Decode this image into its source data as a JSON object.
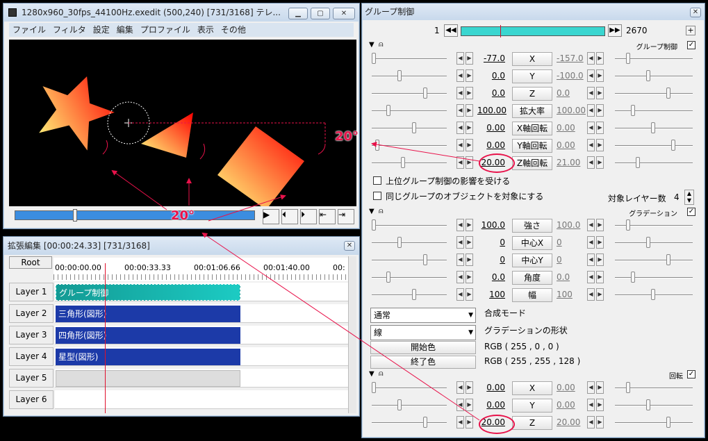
{
  "preview_window": {
    "title": "1280x960_30fps_44100Hz.exedit (500,240)  [731/3168]  テレ...",
    "menu": [
      "ファイル",
      "フィルタ",
      "設定",
      "編集",
      "プロファイル",
      "表示",
      "その他"
    ]
  },
  "timeline_window": {
    "title": "拡張編集 [00:00:24.33] [731/3168]",
    "root_label": "Root",
    "times": [
      "00:00:00.00",
      "00:00:33.33",
      "00:01:06.66",
      "00:01:40.00",
      "00:"
    ],
    "layers": [
      {
        "label": "Layer 1",
        "clip": "グループ制御",
        "color": "#19b8b2"
      },
      {
        "label": "Layer 2",
        "clip": "三角形(図形)",
        "color": "#1c3aa8"
      },
      {
        "label": "Layer 3",
        "clip": "四角形(図形)",
        "color": "#1c3aa8"
      },
      {
        "label": "Layer 4",
        "clip": "星型(図形)",
        "color": "#1c3aa8"
      },
      {
        "label": "Layer 5",
        "clip": "",
        "color": ""
      },
      {
        "label": "Layer 6",
        "clip": "",
        "color": ""
      }
    ]
  },
  "props_window": {
    "title": "グループ制御",
    "frame_start": "1",
    "frame_end": "2670",
    "group_section": {
      "label": "グループ制御",
      "checked": true
    },
    "group_rows": [
      {
        "left": "-77.0",
        "name": "X",
        "right": "-157.0"
      },
      {
        "left": "0.0",
        "name": "Y",
        "right": "-100.0"
      },
      {
        "left": "0.0",
        "name": "Z",
        "right": "0.0"
      },
      {
        "left": "100.00",
        "name": "拡大率",
        "right": "100.00"
      },
      {
        "left": "0.00",
        "name": "X軸回転",
        "right": "0.00"
      },
      {
        "left": "0.00",
        "name": "Y軸回転",
        "right": "0.00"
      },
      {
        "left": "20.00",
        "name": "Z軸回転",
        "right": "21.00"
      }
    ],
    "check1": "上位グループ制御の影響を受ける",
    "check2": "同じグループのオブジェクトを対象にする",
    "target_layers_label": "対象レイヤー数",
    "target_layers_value": "4",
    "grad_section": {
      "label": "グラデーション",
      "checked": true
    },
    "grad_rows": [
      {
        "left": "100.0",
        "name": "強さ",
        "right": "100.0"
      },
      {
        "left": "0",
        "name": "中心X",
        "right": "0"
      },
      {
        "left": "0",
        "name": "中心Y",
        "right": "0"
      },
      {
        "left": "0.0",
        "name": "角度",
        "right": "0.0"
      },
      {
        "left": "100",
        "name": "幅",
        "right": "100"
      }
    ],
    "blend_mode_value": "通常",
    "blend_mode_label": "合成モード",
    "grad_shape_value": "線",
    "grad_shape_label": "グラデーションの形状",
    "start_color_btn": "開始色",
    "start_color_value": "RGB ( 255 , 0 , 0 )",
    "end_color_btn": "終了色",
    "end_color_value": "RGB ( 255 , 255 , 128 )",
    "rot_section": {
      "label": "回転",
      "checked": true
    },
    "rot_rows": [
      {
        "left": "0.00",
        "name": "X",
        "right": "0.00"
      },
      {
        "left": "0.00",
        "name": "Y",
        "right": "0.00"
      },
      {
        "left": "20.00",
        "name": "Z",
        "right": "20.00"
      }
    ]
  },
  "annotations": {
    "angle1": "20°",
    "angle2": "20°"
  },
  "colors": {
    "annotation": "#e8124a",
    "group_clip": "#19b8b2",
    "shape_clip": "#1c3aa8",
    "frame_bar": "#3ad6d0"
  }
}
